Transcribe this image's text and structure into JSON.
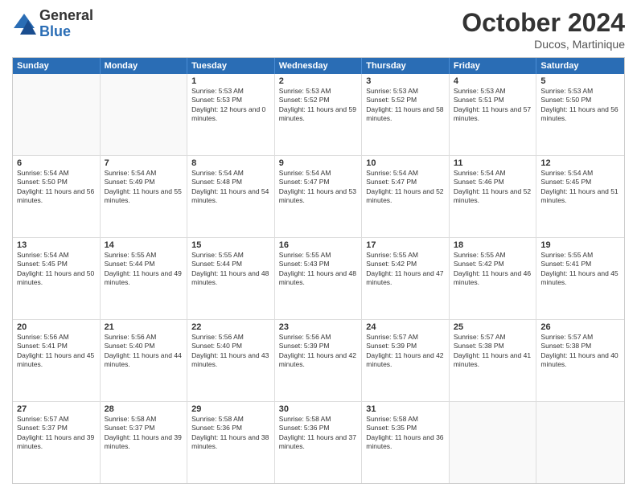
{
  "logo": {
    "general": "General",
    "blue": "Blue"
  },
  "title": "October 2024",
  "location": "Ducos, Martinique",
  "header_days": [
    "Sunday",
    "Monday",
    "Tuesday",
    "Wednesday",
    "Thursday",
    "Friday",
    "Saturday"
  ],
  "weeks": [
    [
      {
        "day": "",
        "text": ""
      },
      {
        "day": "",
        "text": ""
      },
      {
        "day": "1",
        "text": "Sunrise: 5:53 AM\nSunset: 5:53 PM\nDaylight: 12 hours and 0 minutes."
      },
      {
        "day": "2",
        "text": "Sunrise: 5:53 AM\nSunset: 5:52 PM\nDaylight: 11 hours and 59 minutes."
      },
      {
        "day": "3",
        "text": "Sunrise: 5:53 AM\nSunset: 5:52 PM\nDaylight: 11 hours and 58 minutes."
      },
      {
        "day": "4",
        "text": "Sunrise: 5:53 AM\nSunset: 5:51 PM\nDaylight: 11 hours and 57 minutes."
      },
      {
        "day": "5",
        "text": "Sunrise: 5:53 AM\nSunset: 5:50 PM\nDaylight: 11 hours and 56 minutes."
      }
    ],
    [
      {
        "day": "6",
        "text": "Sunrise: 5:54 AM\nSunset: 5:50 PM\nDaylight: 11 hours and 56 minutes."
      },
      {
        "day": "7",
        "text": "Sunrise: 5:54 AM\nSunset: 5:49 PM\nDaylight: 11 hours and 55 minutes."
      },
      {
        "day": "8",
        "text": "Sunrise: 5:54 AM\nSunset: 5:48 PM\nDaylight: 11 hours and 54 minutes."
      },
      {
        "day": "9",
        "text": "Sunrise: 5:54 AM\nSunset: 5:47 PM\nDaylight: 11 hours and 53 minutes."
      },
      {
        "day": "10",
        "text": "Sunrise: 5:54 AM\nSunset: 5:47 PM\nDaylight: 11 hours and 52 minutes."
      },
      {
        "day": "11",
        "text": "Sunrise: 5:54 AM\nSunset: 5:46 PM\nDaylight: 11 hours and 52 minutes."
      },
      {
        "day": "12",
        "text": "Sunrise: 5:54 AM\nSunset: 5:45 PM\nDaylight: 11 hours and 51 minutes."
      }
    ],
    [
      {
        "day": "13",
        "text": "Sunrise: 5:54 AM\nSunset: 5:45 PM\nDaylight: 11 hours and 50 minutes."
      },
      {
        "day": "14",
        "text": "Sunrise: 5:55 AM\nSunset: 5:44 PM\nDaylight: 11 hours and 49 minutes."
      },
      {
        "day": "15",
        "text": "Sunrise: 5:55 AM\nSunset: 5:44 PM\nDaylight: 11 hours and 48 minutes."
      },
      {
        "day": "16",
        "text": "Sunrise: 5:55 AM\nSunset: 5:43 PM\nDaylight: 11 hours and 48 minutes."
      },
      {
        "day": "17",
        "text": "Sunrise: 5:55 AM\nSunset: 5:42 PM\nDaylight: 11 hours and 47 minutes."
      },
      {
        "day": "18",
        "text": "Sunrise: 5:55 AM\nSunset: 5:42 PM\nDaylight: 11 hours and 46 minutes."
      },
      {
        "day": "19",
        "text": "Sunrise: 5:55 AM\nSunset: 5:41 PM\nDaylight: 11 hours and 45 minutes."
      }
    ],
    [
      {
        "day": "20",
        "text": "Sunrise: 5:56 AM\nSunset: 5:41 PM\nDaylight: 11 hours and 45 minutes."
      },
      {
        "day": "21",
        "text": "Sunrise: 5:56 AM\nSunset: 5:40 PM\nDaylight: 11 hours and 44 minutes."
      },
      {
        "day": "22",
        "text": "Sunrise: 5:56 AM\nSunset: 5:40 PM\nDaylight: 11 hours and 43 minutes."
      },
      {
        "day": "23",
        "text": "Sunrise: 5:56 AM\nSunset: 5:39 PM\nDaylight: 11 hours and 42 minutes."
      },
      {
        "day": "24",
        "text": "Sunrise: 5:57 AM\nSunset: 5:39 PM\nDaylight: 11 hours and 42 minutes."
      },
      {
        "day": "25",
        "text": "Sunrise: 5:57 AM\nSunset: 5:38 PM\nDaylight: 11 hours and 41 minutes."
      },
      {
        "day": "26",
        "text": "Sunrise: 5:57 AM\nSunset: 5:38 PM\nDaylight: 11 hours and 40 minutes."
      }
    ],
    [
      {
        "day": "27",
        "text": "Sunrise: 5:57 AM\nSunset: 5:37 PM\nDaylight: 11 hours and 39 minutes."
      },
      {
        "day": "28",
        "text": "Sunrise: 5:58 AM\nSunset: 5:37 PM\nDaylight: 11 hours and 39 minutes."
      },
      {
        "day": "29",
        "text": "Sunrise: 5:58 AM\nSunset: 5:36 PM\nDaylight: 11 hours and 38 minutes."
      },
      {
        "day": "30",
        "text": "Sunrise: 5:58 AM\nSunset: 5:36 PM\nDaylight: 11 hours and 37 minutes."
      },
      {
        "day": "31",
        "text": "Sunrise: 5:58 AM\nSunset: 5:35 PM\nDaylight: 11 hours and 36 minutes."
      },
      {
        "day": "",
        "text": ""
      },
      {
        "day": "",
        "text": ""
      }
    ]
  ]
}
